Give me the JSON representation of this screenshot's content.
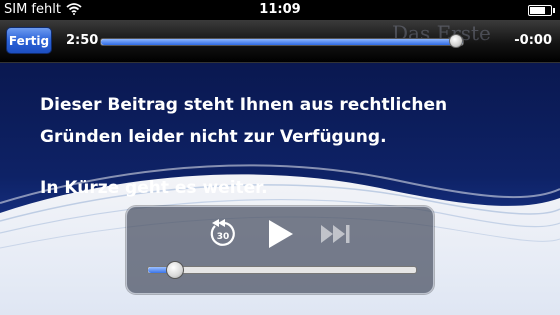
{
  "status_bar": {
    "carrier": "SIM fehlt",
    "time": "11:09",
    "wifi_icon": "wifi-icon",
    "battery_icon": "battery-icon"
  },
  "player": {
    "done_label": "Fertig",
    "elapsed": "2:50",
    "remaining": "-0:00",
    "progress_percent": 100,
    "logo_text": "Das Erste"
  },
  "video": {
    "message_line1": "Dieser Beitrag steht Ihnen aus rechtlichen",
    "message_line2": "Gründen leider nicht zur Verfügung.",
    "message_line3": "In Kürze geht es weiter."
  },
  "controls": {
    "rewind_icon": "rewind-30-icon",
    "rewind_label": "30",
    "play_icon": "play-icon",
    "skip_icon": "skip-forward-icon",
    "volume_percent": 10
  },
  "colors": {
    "accent_blue": "#2f6be5",
    "done_button": "#2b63d8",
    "background": "#0b1a4a"
  }
}
